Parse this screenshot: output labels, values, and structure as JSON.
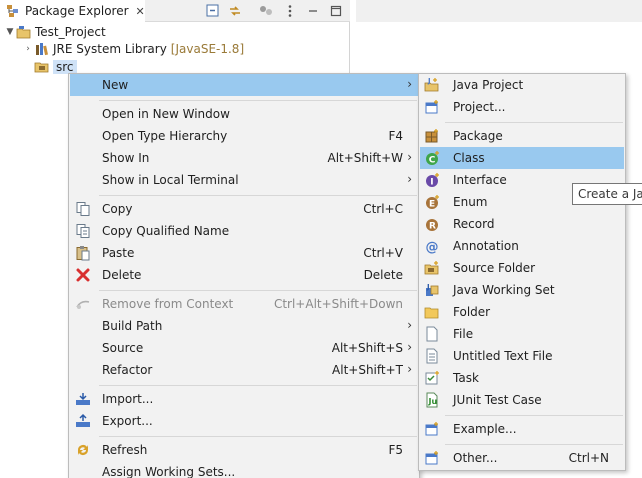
{
  "view": {
    "tab_title": "Package Explorer",
    "close_glyph": "✕"
  },
  "tree": {
    "project": "Test_Project",
    "library": "JRE System Library",
    "library_decoration": "[JavaSE-1.8]",
    "src": "src"
  },
  "context_menu": {
    "items": [
      {
        "label": "New",
        "shortcut": "",
        "submenu": true
      },
      {
        "label": "Open in New Window",
        "shortcut": ""
      },
      {
        "label": "Open Type Hierarchy",
        "shortcut": "F4"
      },
      {
        "label": "Show In",
        "shortcut": "Alt+Shift+W",
        "submenu": true
      },
      {
        "label": "Show in Local Terminal",
        "shortcut": "",
        "submenu": true
      },
      {
        "label": "Copy",
        "shortcut": "Ctrl+C"
      },
      {
        "label": "Copy Qualified Name",
        "shortcut": ""
      },
      {
        "label": "Paste",
        "shortcut": "Ctrl+V"
      },
      {
        "label": "Delete",
        "shortcut": "Delete"
      },
      {
        "label": "Remove from Context",
        "shortcut": "Ctrl+Alt+Shift+Down",
        "disabled": true
      },
      {
        "label": "Build Path",
        "shortcut": "",
        "submenu": true
      },
      {
        "label": "Source",
        "shortcut": "Alt+Shift+S",
        "submenu": true
      },
      {
        "label": "Refactor",
        "shortcut": "Alt+Shift+T",
        "submenu": true
      },
      {
        "label": "Import...",
        "shortcut": ""
      },
      {
        "label": "Export...",
        "shortcut": ""
      },
      {
        "label": "Refresh",
        "shortcut": "F5"
      },
      {
        "label": "Assign Working Sets...",
        "shortcut": ""
      }
    ],
    "submenu_arrow": "›"
  },
  "new_submenu": {
    "items": [
      {
        "label": "Java Project",
        "shortcut": ""
      },
      {
        "label": "Project...",
        "shortcut": ""
      },
      {
        "label": "Package",
        "shortcut": ""
      },
      {
        "label": "Class",
        "shortcut": ""
      },
      {
        "label": "Interface",
        "shortcut": ""
      },
      {
        "label": "Enum",
        "shortcut": ""
      },
      {
        "label": "Record",
        "shortcut": ""
      },
      {
        "label": "Annotation",
        "shortcut": ""
      },
      {
        "label": "Source Folder",
        "shortcut": ""
      },
      {
        "label": "Java Working Set",
        "shortcut": ""
      },
      {
        "label": "Folder",
        "shortcut": ""
      },
      {
        "label": "File",
        "shortcut": ""
      },
      {
        "label": "Untitled Text File",
        "shortcut": ""
      },
      {
        "label": "Task",
        "shortcut": ""
      },
      {
        "label": "JUnit Test Case",
        "shortcut": ""
      },
      {
        "label": "Example...",
        "shortcut": ""
      },
      {
        "label": "Other...",
        "shortcut": "Ctrl+N"
      }
    ]
  },
  "tooltip": {
    "text": "Create a Jav"
  },
  "colors": {
    "highlight": "#99c9ef",
    "menu_bg": "#f2f2f2",
    "selection": "#cfe2f7"
  }
}
